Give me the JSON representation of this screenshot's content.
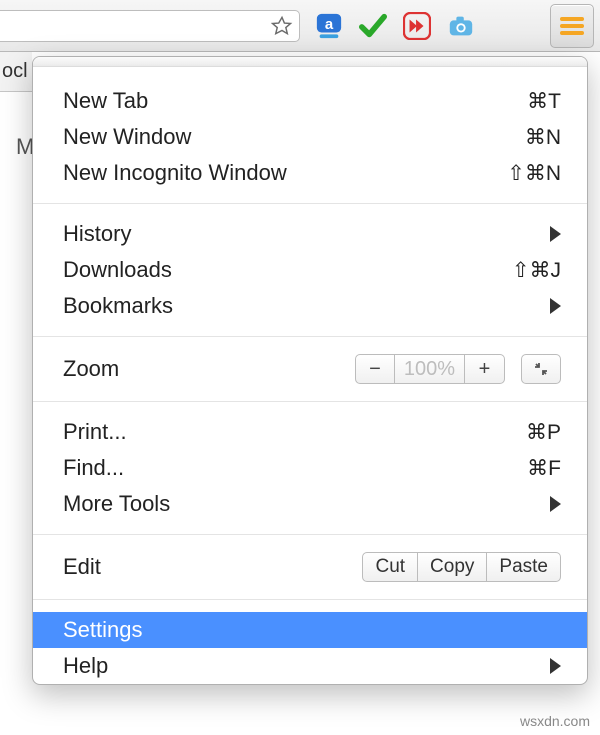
{
  "toolbar": {
    "tab_text_fragment": "ocl",
    "ghost_left": "M"
  },
  "menu": {
    "new_tab": {
      "label": "New Tab",
      "shortcut": "⌘T"
    },
    "new_window": {
      "label": "New Window",
      "shortcut": "⌘N"
    },
    "new_incognito": {
      "label": "New Incognito Window",
      "shortcut": "⇧⌘N"
    },
    "history": {
      "label": "History"
    },
    "downloads": {
      "label": "Downloads",
      "shortcut": "⇧⌘J"
    },
    "bookmarks": {
      "label": "Bookmarks"
    },
    "zoom": {
      "label": "Zoom",
      "percent": "100%"
    },
    "print": {
      "label": "Print...",
      "shortcut": "⌘P"
    },
    "find": {
      "label": "Find...",
      "shortcut": "⌘F"
    },
    "more_tools": {
      "label": "More Tools"
    },
    "edit": {
      "label": "Edit",
      "cut": "Cut",
      "copy": "Copy",
      "paste": "Paste"
    },
    "settings": {
      "label": "Settings"
    },
    "help": {
      "label": "Help"
    }
  },
  "watermark": "wsxdn.com"
}
